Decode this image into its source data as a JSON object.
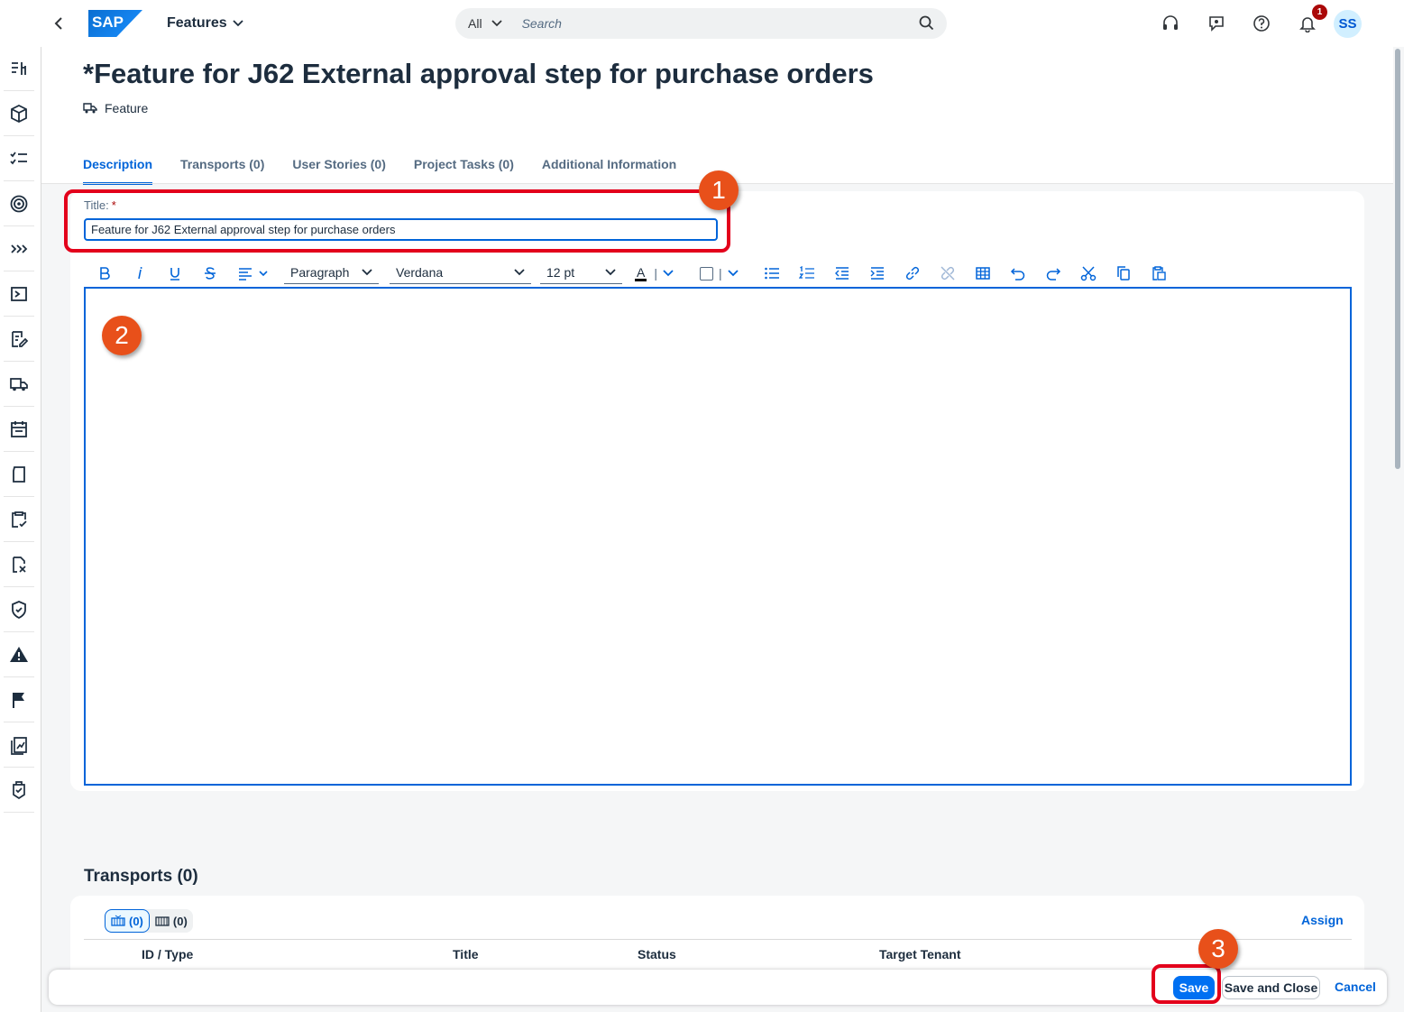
{
  "shell": {
    "app_title": "Features",
    "logo_text": "SAP",
    "search_scope": "All",
    "search_placeholder": "Search",
    "notification_count": "1",
    "avatar_initials": "SS"
  },
  "page": {
    "title": "*Feature for J62 External approval step for purchase orders",
    "object_type": "Feature"
  },
  "tabs": [
    {
      "label": "Description",
      "active": true
    },
    {
      "label": "Transports (0)"
    },
    {
      "label": "User Stories (0)"
    },
    {
      "label": "Project Tasks (0)"
    },
    {
      "label": "Additional Information"
    }
  ],
  "form": {
    "title_label": "Title:",
    "required_mark": "*",
    "title_value": "Feature for J62 External approval step for purchase orders"
  },
  "editor_toolbar": {
    "block_format": "Paragraph",
    "font_family": "Verdana",
    "font_size": "12 pt",
    "font_color_glyph": "A"
  },
  "transports": {
    "section_title": "Transports (0)",
    "open_count": "(0)",
    "released_count": "(0)",
    "assign_label": "Assign",
    "columns": [
      "ID / Type",
      "Title",
      "Status",
      "Target Tenant"
    ]
  },
  "footer": {
    "save_label": "Save",
    "save_close_label": "Save and Close",
    "cancel_label": "Cancel"
  },
  "annotations": {
    "marker_1": "1",
    "marker_2": "2",
    "marker_3": "3"
  },
  "colors": {
    "brand_blue": "#0064d9",
    "highlight_red": "#e3001b",
    "marker_orange": "#e8501a"
  }
}
